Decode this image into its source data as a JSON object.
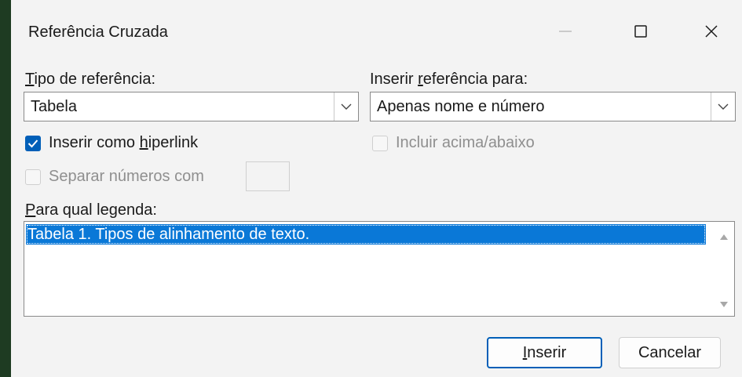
{
  "window": {
    "title": "Referência Cruzada"
  },
  "tipo_referencia": {
    "label_pre": "",
    "label_access": "T",
    "label_post": "ipo de referência:",
    "value": "Tabela"
  },
  "inserir_referencia": {
    "label_pre": "Inserir ",
    "label_access": "r",
    "label_post": "eferência para:",
    "value": "Apenas nome e número"
  },
  "hiperlink": {
    "label_pre": "Inserir como ",
    "label_access": "h",
    "label_post": "iperlink",
    "checked": true
  },
  "incluir": {
    "label": "Incluir acima/abaixo",
    "checked": false,
    "enabled": false
  },
  "separar": {
    "label": "Separar números com",
    "checked": false,
    "enabled": false,
    "value": ""
  },
  "legenda": {
    "label_pre": "",
    "label_access": "P",
    "label_post": "ara qual legenda:",
    "items": [
      "Tabela 1. Tipos de alinhamento de texto."
    ]
  },
  "buttons": {
    "inserir_access": "I",
    "inserir_rest": "nserir",
    "cancelar": "Cancelar"
  },
  "colors": {
    "accent": "#005fb8",
    "selection": "#0a78d7"
  },
  "icons": [
    "minimize-icon",
    "maximize-icon",
    "close-icon",
    "chevron-down-icon",
    "checkmark-icon",
    "scroll-up-arrow-icon",
    "scroll-down-arrow-icon"
  ]
}
